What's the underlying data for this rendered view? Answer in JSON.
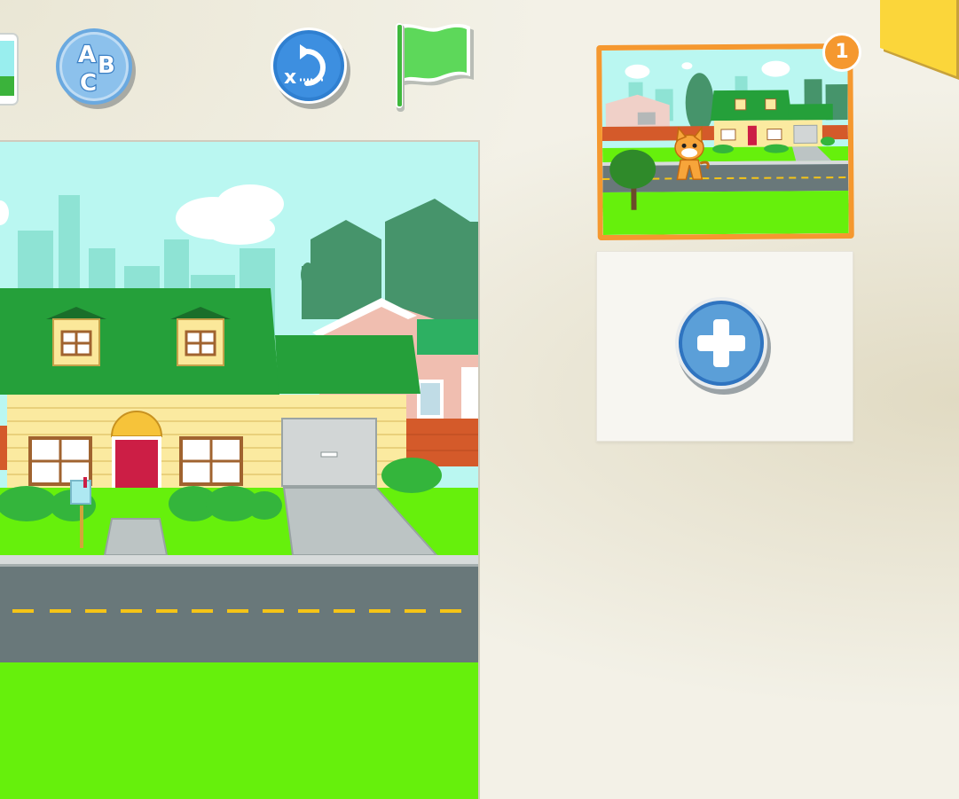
{
  "toolbar": {
    "left_partial_button": {
      "icon": "picture-icon"
    },
    "text_button": {
      "icon": "abc-text-icon",
      "letters": [
        "A",
        "B",
        "C"
      ]
    },
    "reset_button": {
      "icon": "reset-characters-icon",
      "glyph": "x"
    },
    "green_flag_button": {
      "icon": "green-flag-icon"
    }
  },
  "stage": {
    "scene": "suburban-house-street"
  },
  "pages": {
    "items": [
      {
        "number": "1",
        "selected": true
      }
    ],
    "add_page": {
      "icon": "plus-icon"
    }
  },
  "corner": {
    "icon": "yellow-corner-tab"
  },
  "colors": {
    "accent": "#f5982f",
    "button_blue": "#5b9fd8",
    "flag_green": "#5dd85a",
    "grass": "#66f00c",
    "sky": "#baf7f1",
    "roof": "#25a03a",
    "road": "#69787a"
  }
}
